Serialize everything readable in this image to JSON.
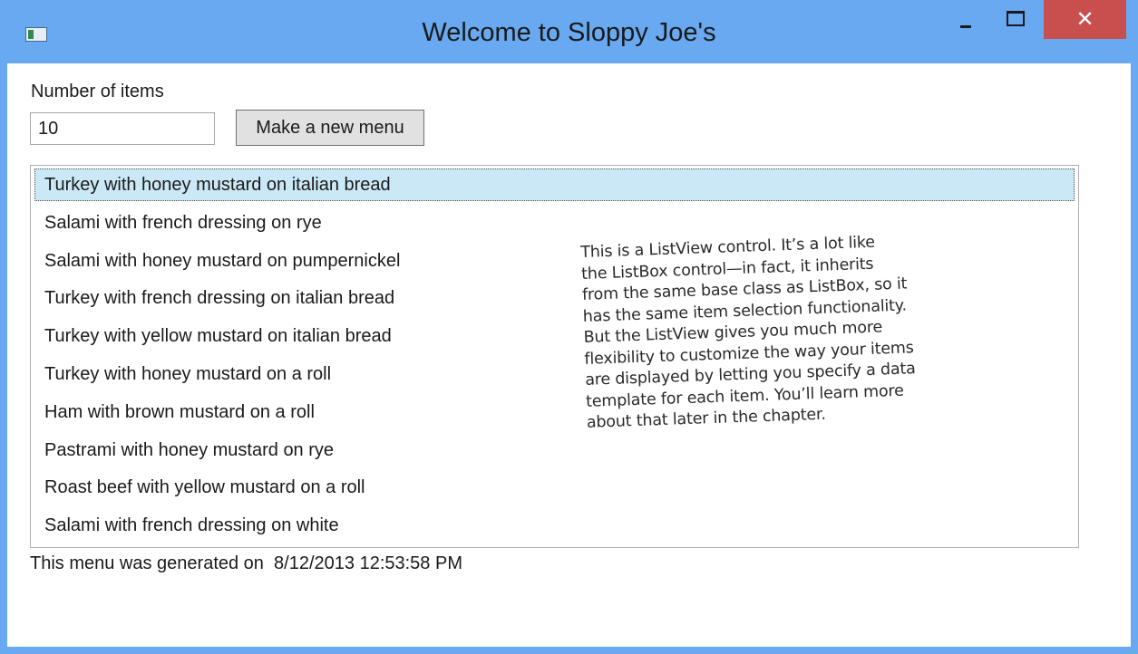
{
  "window": {
    "title": "Welcome to Sloppy Joe's",
    "icon": "app-window-icon",
    "controls": {
      "minimize_icon": "minimize-icon",
      "maximize_icon": "maximize-icon",
      "close_label": "✕"
    },
    "colors": {
      "frame": "#68a9f1",
      "close": "#c94f4f",
      "selection": "#cbe8f6"
    }
  },
  "form": {
    "items_label": "Number of items",
    "items_value": "10",
    "make_button_label": "Make a new menu"
  },
  "listview": {
    "items": [
      {
        "label": "Turkey with honey mustard on italian bread",
        "selected": true
      },
      {
        "label": "Salami with french dressing on rye",
        "selected": false
      },
      {
        "label": "Salami with honey mustard on pumpernickel",
        "selected": false
      },
      {
        "label": "Turkey with french dressing on italian bread",
        "selected": false
      },
      {
        "label": "Turkey with yellow mustard on italian bread",
        "selected": false
      },
      {
        "label": "Turkey with honey mustard on a roll",
        "selected": false
      },
      {
        "label": "Ham with brown mustard on a roll",
        "selected": false
      },
      {
        "label": "Pastrami with honey mustard on rye",
        "selected": false
      },
      {
        "label": "Roast beef with yellow mustard on a roll",
        "selected": false
      },
      {
        "label": "Salami with french dressing on white",
        "selected": false
      }
    ]
  },
  "annotation": {
    "lines": [
      "This is a ListView control. It’s a lot like",
      "the ListBox control—in fact, it inherits",
      "from the same base class as ListBox, so it",
      "has the same item selection functionality.",
      "But the ListView gives you much more",
      "flexibility to customize the way your items",
      "are displayed by letting you specify a data",
      "template for each item. You’ll learn more",
      "about that later in the chapter."
    ]
  },
  "status": {
    "text": "This menu was generated on  8/12/2013 12:53:58 PM"
  }
}
